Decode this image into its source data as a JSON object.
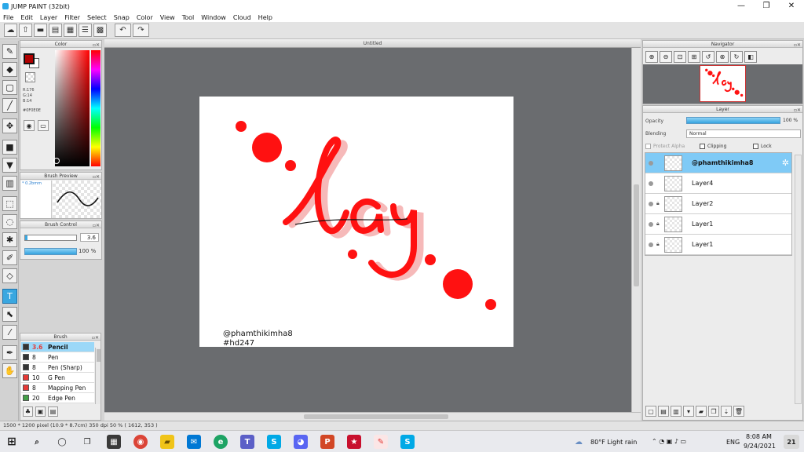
{
  "window": {
    "title": "JUMP PAINT (32bit)",
    "minimize_glyph": "—",
    "restore_glyph": "❐",
    "close_glyph": "✕"
  },
  "menu": [
    "File",
    "Edit",
    "Layer",
    "Filter",
    "Select",
    "Snap",
    "Color",
    "View",
    "Tool",
    "Window",
    "Cloud",
    "Help"
  ],
  "panels": {
    "color_title": "Color",
    "brush_preview_title": "Brush Preview",
    "brush_control_title": "Brush Control",
    "brush_title": "Brush",
    "navigator_title": "Navigator",
    "layer_title": "Layer"
  },
  "color": {
    "foreground": "#B00000",
    "r_line": "R:176",
    "g_line": "G:14",
    "b_line": "B:14",
    "hex": "#0F0E0E"
  },
  "brush_preview": {
    "size_text": "* 0.2bmm"
  },
  "brush_control": {
    "size_value": "3.6",
    "opacity_value": "100 %"
  },
  "brushes": [
    {
      "size": "3.6",
      "name": "Pencil",
      "color": "#333333"
    },
    {
      "size": "8",
      "name": "Pen",
      "color": "#333333"
    },
    {
      "size": "8",
      "name": "Pen (Sharp)",
      "color": "#333333"
    },
    {
      "size": "10",
      "name": "G Pen",
      "color": "#e53935"
    },
    {
      "size": "8",
      "name": "Mapping Pen",
      "color": "#e53935"
    },
    {
      "size": "20",
      "name": "Edge Pen",
      "color": "#43a047"
    }
  ],
  "document": {
    "tab_name": "Untitled",
    "credit_line1": "@phamthikimha8",
    "credit_line2": "#hd247",
    "lettering": "lay"
  },
  "layer": {
    "opacity_label": "Opacity",
    "opacity_value": "100 %",
    "blending_label": "Blending",
    "blending_value": "Normal",
    "protect_alpha": "Protect Alpha",
    "clipping": "Clipping",
    "lock": "Lock",
    "layers": [
      {
        "name": "@phamthikimha8",
        "selected": true,
        "locked": false
      },
      {
        "name": "Layer4",
        "selected": false,
        "locked": false
      },
      {
        "name": "Layer2",
        "selected": false,
        "locked": true
      },
      {
        "name": "Layer1",
        "selected": false,
        "locked": true
      },
      {
        "name": "Layer1",
        "selected": false,
        "locked": true
      }
    ]
  },
  "status": "1500 * 1200 pixel   (10.9 * 8.7cm)   350 dpi   50 %   ( 1612, 353 )",
  "taskbar": {
    "weather": "80°F  Light rain",
    "lang": "ENG",
    "time": "8:08 AM",
    "date": "9/24/2021",
    "notif": "21"
  }
}
